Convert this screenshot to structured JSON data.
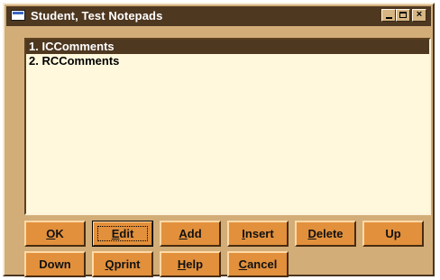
{
  "window": {
    "title": "Student, Test Notepads",
    "controls": [
      "minimize-icon",
      "maximize-icon",
      "close-icon"
    ]
  },
  "list": {
    "items": [
      {
        "label": "1. ICComments",
        "selected": true
      },
      {
        "label": "2. RCComments",
        "selected": false
      }
    ]
  },
  "buttons": {
    "ok": {
      "mn": "O",
      "rest": "K"
    },
    "edit": {
      "mn": "E",
      "rest": "dit"
    },
    "add": {
      "mn": "A",
      "rest": "dd"
    },
    "insert": {
      "mn": "I",
      "rest": "nsert"
    },
    "delete": {
      "mn": "D",
      "rest": "elete"
    },
    "up": {
      "label": "Up"
    },
    "down": {
      "label": "Down"
    },
    "qprint": {
      "mn": "Q",
      "rest": "print"
    },
    "help": {
      "mn": "H",
      "rest": "elp"
    },
    "cancel": {
      "mn": "C",
      "rest": "ancel"
    }
  },
  "colors": {
    "title_bar": "#4f3820",
    "window_face": "#d2ad78",
    "list_background": "#fff8dc",
    "button_face": "#e2903c"
  }
}
